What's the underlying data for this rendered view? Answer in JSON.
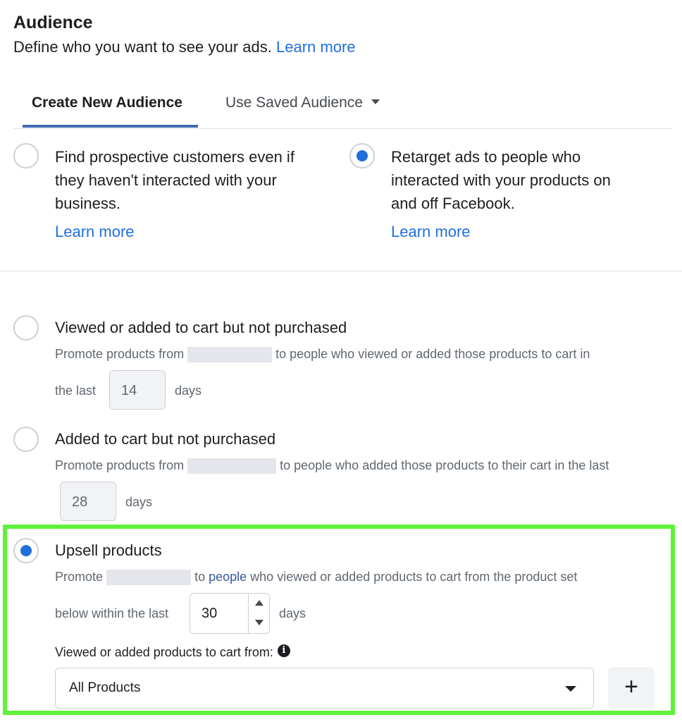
{
  "header": {
    "title": "Audience",
    "subtitle": "Define who you want to see your ads.",
    "learn_more": "Learn more"
  },
  "tabs": {
    "create": "Create New Audience",
    "saved": "Use Saved Audience"
  },
  "audience_options": [
    {
      "lines": [
        "Find prospective customers even if",
        "they haven't interacted with your",
        "business."
      ],
      "link": "Learn more",
      "selected": false
    },
    {
      "lines": [
        "Retarget ads to people who",
        "interacted with your products on",
        "and off Facebook."
      ],
      "link": "Learn more",
      "selected": true
    }
  ],
  "retarget_options": [
    {
      "title": "Viewed or added to cart but not purchased",
      "desc_before": "Promote products from",
      "desc_after": "to people who viewed or added those products to cart in",
      "line2_prefix": "the last",
      "days_value": "14",
      "days_label": "days",
      "selected": false
    },
    {
      "title": "Added to cart but not purchased",
      "desc_before": "Promote products from",
      "desc_after": "to people who added those products to their cart in the last",
      "days_value": "28",
      "days_label": "days",
      "selected": false
    },
    {
      "title": "Upsell products",
      "desc_before": "Promote",
      "desc_to": "to",
      "desc_link": "people",
      "desc_after": "who viewed or added products to cart from the product set",
      "line2_prefix": "below within the last",
      "days_value": "30",
      "days_label": "days",
      "selected": true,
      "product_set_label": "Viewed or added products to cart from:",
      "product_set_value": "All Products",
      "add_label": "+"
    }
  ],
  "colors": {
    "accent": "#216fdb",
    "tab_underline": "#4267b2",
    "highlight": "#5ff23a"
  }
}
